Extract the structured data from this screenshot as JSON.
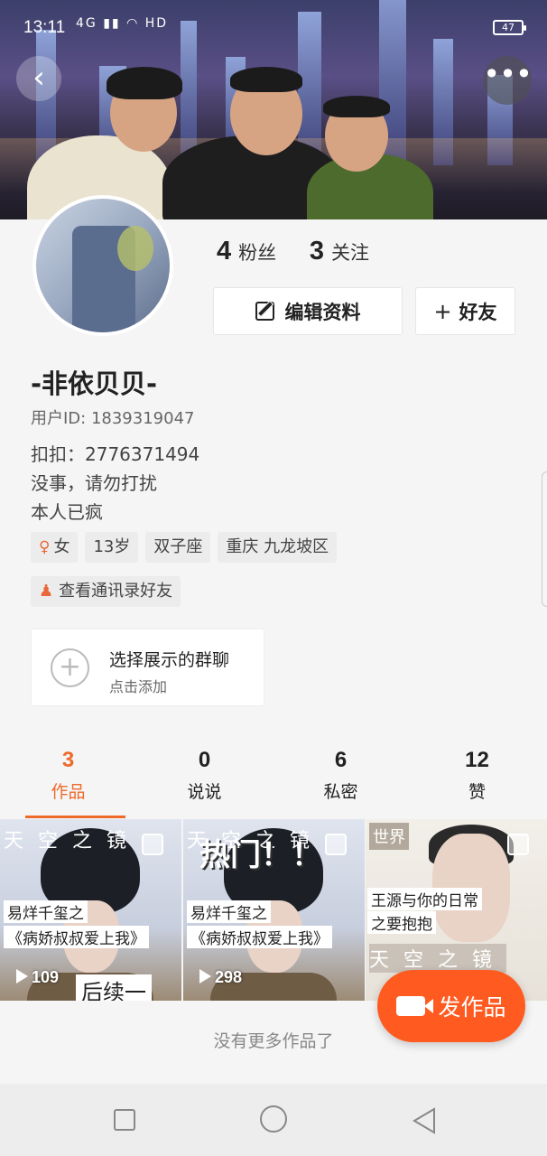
{
  "status_bar": {
    "time": "13:11",
    "signal": "4G",
    "network": "HD",
    "battery": "47"
  },
  "header": {
    "back_icon": "chevron-left-icon",
    "more_icon": "more-dots-icon"
  },
  "profile": {
    "followers_count": "4",
    "followers_label": "粉丝",
    "following_count": "3",
    "following_label": "关注",
    "edit_label": "编辑资料",
    "add_friend_label": "好友",
    "name": "-非依贝贝-",
    "user_id": "用户ID: 1839319047",
    "bio": [
      "扣扣：2776371494",
      "没事，请勿打扰",
      "本人已疯"
    ],
    "tags": {
      "gender": "女",
      "age": "13岁",
      "zodiac": "双子座",
      "location": "重庆 九龙坡区"
    },
    "contacts_label": "查看通讯录好友"
  },
  "group_card": {
    "title": "选择展示的群聊",
    "subtitle": "点击添加"
  },
  "tabs": [
    {
      "count": "3",
      "label": "作品"
    },
    {
      "count": "0",
      "label": "说说"
    },
    {
      "count": "6",
      "label": "私密"
    },
    {
      "count": "12",
      "label": "赞"
    }
  ],
  "works": [
    {
      "top_text": "天空之镜",
      "caption1": "易烊千玺之",
      "caption2": "《病娇叔叔爱上我》",
      "plays": "109",
      "extra": "后续一"
    },
    {
      "top_text": "天空之镜",
      "hot": "热门！！",
      "caption1": "易烊千玺之",
      "caption2": "《病娇叔叔爱上我》",
      "plays": "298"
    },
    {
      "world": "世界",
      "caption1": "王源与你的日常",
      "caption2": "之要抱抱",
      "bottom_text": "天空之镜"
    }
  ],
  "fab_label": "发作品",
  "footer_text": "没有更多作品了",
  "accent_color": "#ee6a2a"
}
